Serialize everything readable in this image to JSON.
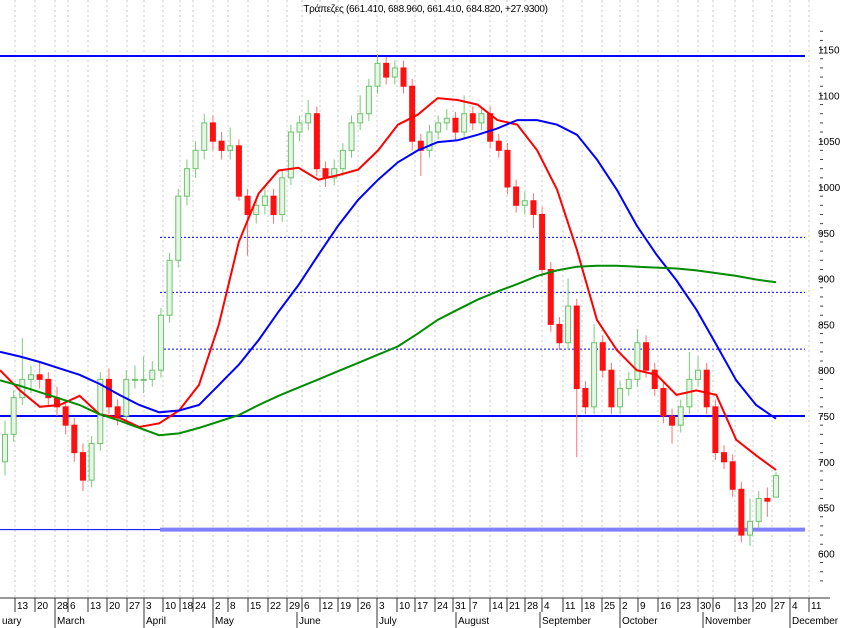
{
  "chart_data": {
    "type": "candlestick",
    "title": "Τράπεζες (661.410, 688.960, 661.410, 684.820, +27.9300)",
    "ylim": [
      560,
      1170
    ],
    "y_ticks": [
      600,
      650,
      700,
      750,
      800,
      850,
      900,
      950,
      1000,
      1050,
      1100,
      1150
    ],
    "x_tick_labels": [
      "13",
      "20",
      "28",
      "6",
      "13",
      "20",
      "27",
      "3",
      "10",
      "18",
      "24",
      "2",
      "8",
      "15",
      "22",
      "29",
      "6",
      "12",
      "19",
      "26",
      "3",
      "10",
      "17",
      "24",
      "31",
      "7",
      "14",
      "21",
      "28",
      "4",
      "11",
      "18",
      "25",
      "2",
      "9",
      "16",
      "23",
      "30",
      "6",
      "13",
      "20",
      "27",
      "4",
      "11"
    ],
    "month_labels": [
      "uary",
      "March",
      "April",
      "May",
      "June",
      "July",
      "August",
      "September",
      "October",
      "November",
      "December"
    ],
    "grid": "vertical dashed",
    "colors": {
      "up": "#22aa22",
      "up_fill": "#e6f5e6",
      "down": "#ff1010",
      "ma_short": "#ff0000",
      "ma_mid": "#0000ff",
      "ma_long": "#008c00",
      "level": "#0000ff",
      "support_band": "#8080ff"
    },
    "candles_ohlc": [
      [
        700,
        745,
        685,
        730
      ],
      [
        730,
        778,
        722,
        770
      ],
      [
        770,
        835,
        762,
        790
      ],
      [
        790,
        805,
        775,
        795
      ],
      [
        795,
        810,
        780,
        790
      ],
      [
        790,
        798,
        762,
        770
      ],
      [
        770,
        782,
        750,
        760
      ],
      [
        760,
        768,
        730,
        740
      ],
      [
        740,
        748,
        700,
        710
      ],
      [
        710,
        720,
        668,
        680
      ],
      [
        680,
        728,
        672,
        720
      ],
      [
        720,
        798,
        712,
        790
      ],
      [
        790,
        802,
        752,
        760
      ],
      [
        760,
        768,
        740,
        750
      ],
      [
        750,
        800,
        742,
        790
      ],
      [
        790,
        805,
        780,
        790
      ],
      [
        790,
        815,
        775,
        790
      ],
      [
        790,
        810,
        782,
        800
      ],
      [
        800,
        868,
        792,
        860
      ],
      [
        860,
        928,
        852,
        920
      ],
      [
        920,
        998,
        912,
        990
      ],
      [
        990,
        1030,
        980,
        1020
      ],
      [
        1020,
        1050,
        1010,
        1040
      ],
      [
        1040,
        1080,
        1030,
        1070
      ],
      [
        1070,
        1078,
        1040,
        1050
      ],
      [
        1050,
        1060,
        1030,
        1040
      ],
      [
        1040,
        1065,
        1030,
        1045
      ],
      [
        1045,
        1052,
        985,
        990
      ],
      [
        990,
        998,
        925,
        970
      ],
      [
        970,
        990,
        960,
        980
      ],
      [
        980,
        1000,
        970,
        990
      ],
      [
        990,
        998,
        960,
        970
      ],
      [
        970,
        1018,
        962,
        1010
      ],
      [
        1010,
        1068,
        1002,
        1060
      ],
      [
        1060,
        1078,
        1050,
        1070
      ],
      [
        1070,
        1095,
        1062,
        1080
      ],
      [
        1080,
        1088,
        1012,
        1020
      ],
      [
        1020,
        1028,
        1000,
        1010
      ],
      [
        1010,
        1030,
        1002,
        1020
      ],
      [
        1020,
        1048,
        1012,
        1040
      ],
      [
        1040,
        1078,
        1032,
        1070
      ],
      [
        1070,
        1100,
        1062,
        1080
      ],
      [
        1080,
        1118,
        1072,
        1110
      ],
      [
        1110,
        1145,
        1102,
        1135
      ],
      [
        1135,
        1142,
        1112,
        1120
      ],
      [
        1120,
        1138,
        1112,
        1130
      ],
      [
        1130,
        1138,
        1102,
        1110
      ],
      [
        1110,
        1118,
        1040,
        1050
      ],
      [
        1050,
        1058,
        1012,
        1040
      ],
      [
        1040,
        1068,
        1032,
        1060
      ],
      [
        1060,
        1078,
        1052,
        1070
      ],
      [
        1070,
        1085,
        1062,
        1075
      ],
      [
        1075,
        1082,
        1052,
        1060
      ],
      [
        1060,
        1100,
        1052,
        1080
      ],
      [
        1080,
        1088,
        1062,
        1070
      ],
      [
        1070,
        1088,
        1062,
        1080
      ],
      [
        1080,
        1088,
        1042,
        1050
      ],
      [
        1050,
        1058,
        1032,
        1040
      ],
      [
        1040,
        1048,
        992,
        1000
      ],
      [
        1000,
        1008,
        972,
        980
      ],
      [
        980,
        995,
        970,
        985
      ],
      [
        985,
        993,
        955,
        970
      ],
      [
        970,
        978,
        902,
        910
      ],
      [
        910,
        918,
        842,
        850
      ],
      [
        850,
        858,
        822,
        830
      ],
      [
        830,
        900,
        822,
        870
      ],
      [
        870,
        878,
        705,
        780
      ],
      [
        780,
        788,
        752,
        760
      ],
      [
        760,
        850,
        752,
        830
      ],
      [
        830,
        838,
        792,
        800
      ],
      [
        800,
        808,
        752,
        760
      ],
      [
        760,
        788,
        752,
        780
      ],
      [
        780,
        798,
        772,
        790
      ],
      [
        790,
        845,
        782,
        830
      ],
      [
        830,
        838,
        792,
        800
      ],
      [
        800,
        808,
        772,
        780
      ],
      [
        780,
        788,
        742,
        750
      ],
      [
        750,
        758,
        720,
        740
      ],
      [
        740,
        768,
        732,
        760
      ],
      [
        760,
        820,
        752,
        790
      ],
      [
        790,
        815,
        782,
        800
      ],
      [
        800,
        808,
        752,
        760
      ],
      [
        760,
        768,
        702,
        710
      ],
      [
        710,
        718,
        692,
        700
      ],
      [
        700,
        708,
        662,
        670
      ],
      [
        670,
        678,
        612,
        620
      ],
      [
        620,
        660,
        608,
        635
      ],
      [
        635,
        668,
        628,
        660
      ],
      [
        660,
        672,
        640,
        657
      ],
      [
        661.41,
        688.96,
        661.41,
        684.82
      ]
    ],
    "moving_averages": [
      {
        "color": "#ff0000",
        "values": [
          800,
          778,
          760,
          762,
          772,
          752,
          748,
          738,
          742,
          756,
          784,
          850,
          940,
          993,
          1018,
          1021,
          1008,
          1013,
          1019,
          1040,
          1068,
          1079,
          1097,
          1095,
          1090,
          1073,
          1068,
          1040,
          997,
          931,
          855,
          822,
          800,
          795,
          773,
          778,
          773,
          724,
          707,
          691
        ]
      },
      {
        "color": "#0000ff",
        "values": [
          820,
          815,
          809,
          802,
          795,
          785,
          773,
          762,
          754,
          756,
          762,
          784,
          806,
          833,
          864,
          893,
          926,
          958,
          986,
          1008,
          1027,
          1040,
          1049,
          1051,
          1057,
          1064,
          1073,
          1073,
          1068,
          1057,
          1030,
          997,
          958,
          926,
          898,
          866,
          828,
          789,
          762,
          747
        ]
      },
      {
        "color": "#008c00",
        "values": [
          789,
          783,
          776,
          769,
          762,
          752,
          745,
          737,
          729,
          731,
          737,
          744,
          751,
          762,
          772,
          781,
          790,
          799,
          808,
          817,
          826,
          840,
          855,
          866,
          877,
          886,
          894,
          903,
          909,
          913,
          914,
          914,
          913,
          912,
          911,
          909,
          906,
          903,
          899,
          896
        ]
      }
    ],
    "horizontal_levels": [
      {
        "value": 1143,
        "style": "solid"
      },
      {
        "value": 945,
        "style": "dotted"
      },
      {
        "value": 885,
        "style": "dotted"
      },
      {
        "value": 823,
        "style": "dotted"
      },
      {
        "value": 750,
        "style": "solid"
      },
      {
        "value": 626,
        "style": "band"
      }
    ]
  }
}
